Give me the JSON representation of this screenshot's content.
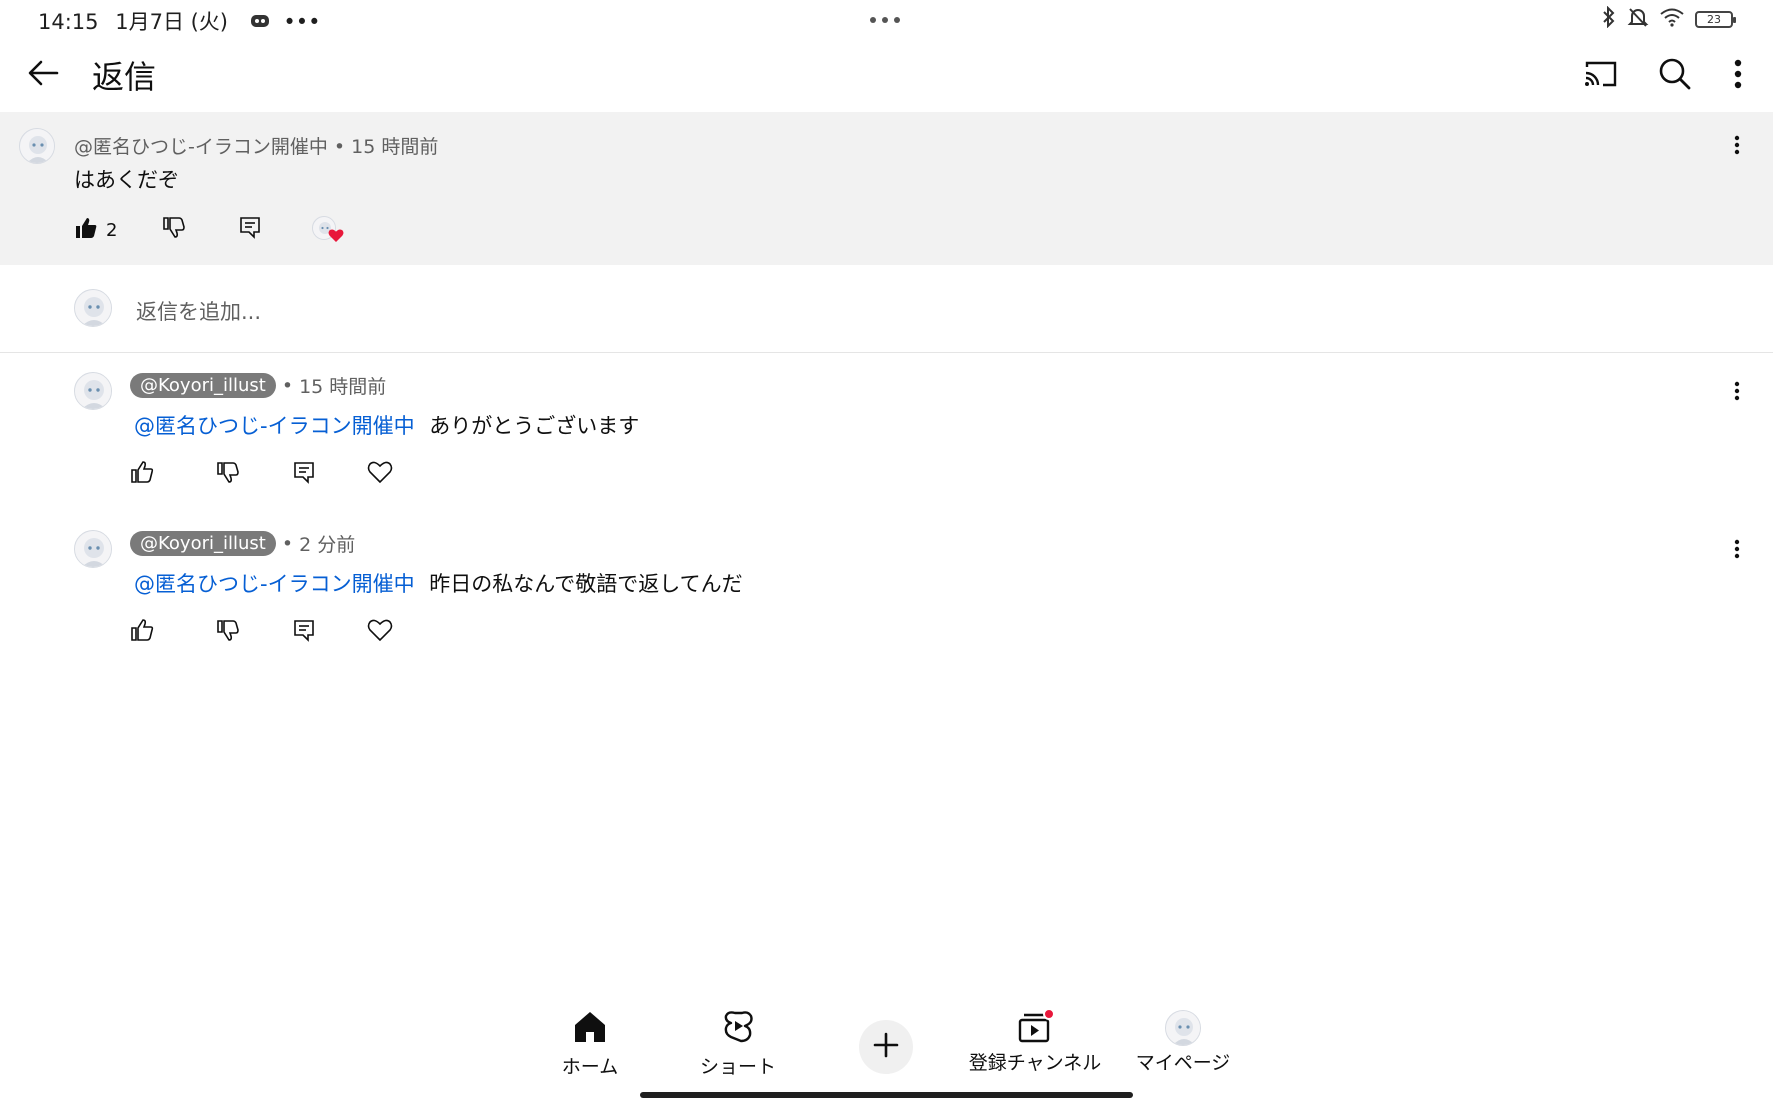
{
  "status_bar": {
    "time": "14:15",
    "date": "1月7日 (火)",
    "more": "•••",
    "battery": "23"
  },
  "header": {
    "title": "返信",
    "icons": [
      "back-arrow-icon",
      "cast-icon",
      "search-icon",
      "more-vert-icon"
    ]
  },
  "parent_comment": {
    "author": "@匿名ひつじ-イラコン開催中",
    "time": "15 時間前",
    "separator": " • ",
    "text": "はあくだぞ",
    "likes": "2"
  },
  "reply_input": {
    "placeholder": "返信を追加..."
  },
  "replies": [
    {
      "author": "@Koyori_illust",
      "time": "15 時間前",
      "mention": "@匿名ひつじ-イラコン開催中",
      "text": "ありがとうございます"
    },
    {
      "author": "@Koyori_illust",
      "time": "2 分前",
      "mention": "@匿名ひつじ-イラコン開催中",
      "text": "昨日の私なんで敬語で返してんだ"
    }
  ],
  "bottom_nav": {
    "home": "ホーム",
    "shorts": "ショート",
    "subscriptions": "登録チャンネル",
    "you": "マイページ"
  },
  "colors": {
    "mention": "#065fd4",
    "highlight_bg": "#f2f2f2",
    "chip_bg": "#7a7a7a",
    "heart_red": "#e8173a"
  }
}
